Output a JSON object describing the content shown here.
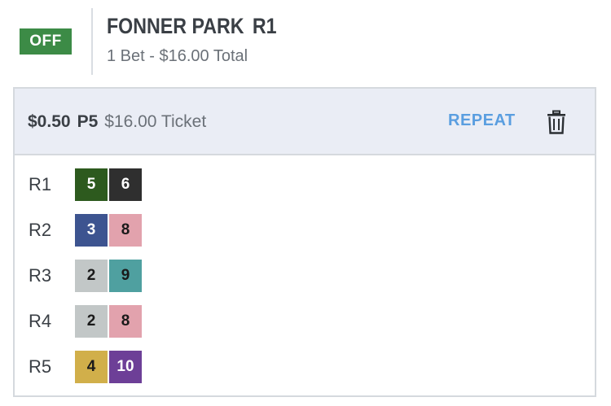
{
  "header": {
    "status": "OFF",
    "track": "FONNER PARK",
    "race": "R1",
    "summary": "1 Bet - $16.00 Total"
  },
  "ticket": {
    "amount": "$0.50",
    "type": "P5",
    "total": "$16.00 Ticket",
    "repeat_label": "REPEAT",
    "delete_icon": "trash-icon"
  },
  "legs": [
    {
      "label": "R1",
      "runners": [
        {
          "number": "5",
          "bg": "#2d5a1e",
          "fg": "#ffffff"
        },
        {
          "number": "6",
          "bg": "#2f2f2f",
          "fg": "#ffffff"
        }
      ]
    },
    {
      "label": "R2",
      "runners": [
        {
          "number": "3",
          "bg": "#3d5490",
          "fg": "#ffffff"
        },
        {
          "number": "8",
          "bg": "#e2a2ad",
          "fg": "#1a1a1a"
        }
      ]
    },
    {
      "label": "R3",
      "runners": [
        {
          "number": "2",
          "bg": "#c2c7c7",
          "fg": "#1a1a1a"
        },
        {
          "number": "9",
          "bg": "#4fa0a0",
          "fg": "#1a1a1a"
        }
      ]
    },
    {
      "label": "R4",
      "runners": [
        {
          "number": "2",
          "bg": "#c2c7c7",
          "fg": "#1a1a1a"
        },
        {
          "number": "8",
          "bg": "#e2a2ad",
          "fg": "#1a1a1a"
        }
      ]
    },
    {
      "label": "R5",
      "runners": [
        {
          "number": "4",
          "bg": "#d1af4a",
          "fg": "#1a1a1a"
        },
        {
          "number": "10",
          "bg": "#6d3f97",
          "fg": "#ffffff"
        }
      ]
    }
  ],
  "colors": {
    "status_green": "#3c8b46",
    "accent_blue": "#5a9ee0",
    "card_header_bg": "#eaedf5"
  }
}
